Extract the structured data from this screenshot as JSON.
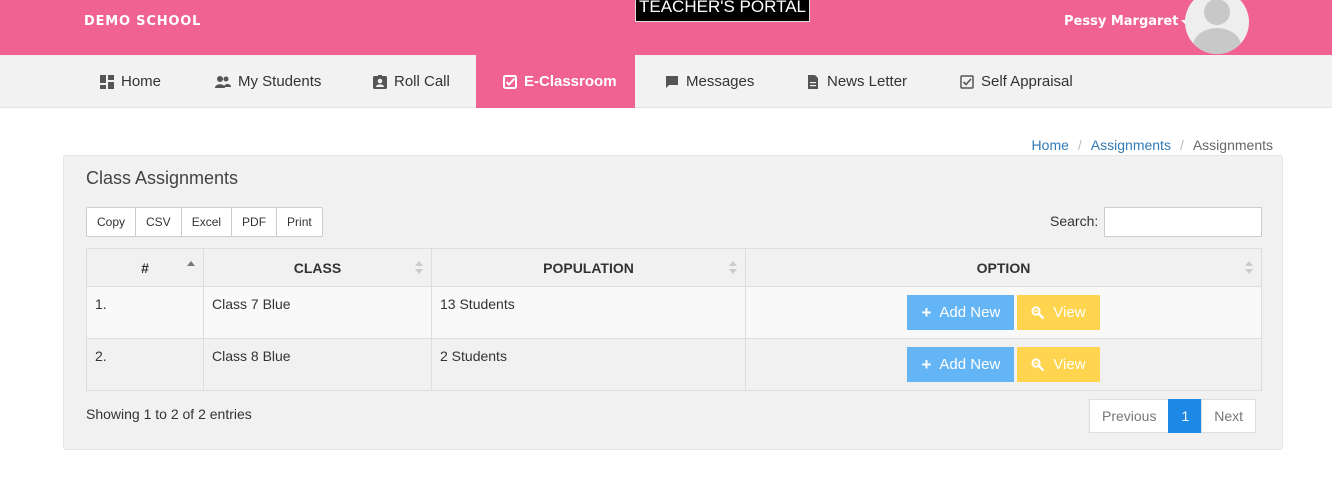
{
  "header": {
    "brand": "DEMO SCHOOL",
    "portal_title": "TEACHER'S PORTAL",
    "user_name": "Pessy Margaret",
    "accent_color": "#f06292"
  },
  "nav": {
    "items": [
      {
        "label": "Home",
        "icon": "dashboard-icon"
      },
      {
        "label": "My Students",
        "icon": "people-icon"
      },
      {
        "label": "Roll Call",
        "icon": "contact-badge-icon"
      },
      {
        "label": "E-Classroom",
        "icon": "check-box-icon",
        "active": true
      },
      {
        "label": "Messages",
        "icon": "chat-bubble-icon"
      },
      {
        "label": "News Letter",
        "icon": "document-icon"
      },
      {
        "label": "Self Appraisal",
        "icon": "check-box-outline-icon"
      }
    ]
  },
  "breadcrumb": {
    "items": [
      "Home",
      "Assignments",
      "Assignments"
    ]
  },
  "panel": {
    "title": "Class Assignments",
    "export_buttons": [
      "Copy",
      "CSV",
      "Excel",
      "PDF",
      "Print"
    ],
    "search_label": "Search:",
    "search_value": ""
  },
  "table": {
    "columns": [
      "#",
      "CLASS",
      "POPULATION",
      "OPTION"
    ],
    "rows": [
      {
        "num": "1.",
        "class": "Class 7 Blue",
        "population": "13 Students",
        "add_label": "Add New",
        "view_label": "View"
      },
      {
        "num": "2.",
        "class": "Class 8 Blue",
        "population": "2 Students",
        "add_label": "Add New",
        "view_label": "View"
      }
    ]
  },
  "footer": {
    "info": "Showing 1 to 2 of 2 entries",
    "pager": {
      "previous": "Previous",
      "current": "1",
      "next": "Next"
    }
  }
}
